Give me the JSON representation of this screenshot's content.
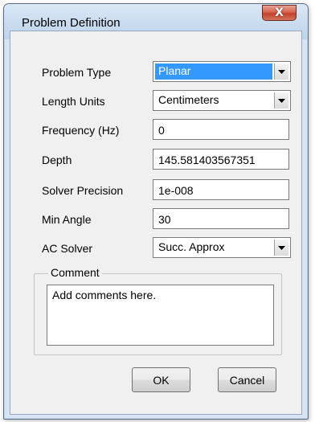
{
  "window": {
    "title": "Problem Definition",
    "close_label": "X"
  },
  "form": {
    "problem_type": {
      "label": "Problem Type",
      "value": "Planar"
    },
    "length_units": {
      "label": "Length Units",
      "value": "Centimeters"
    },
    "frequency": {
      "label": "Frequency (Hz)",
      "value": "0"
    },
    "depth": {
      "label": "Depth",
      "value": "145.581403567351"
    },
    "solver_precision": {
      "label": "Solver Precision",
      "value": "1e-008"
    },
    "min_angle": {
      "label": "Min Angle",
      "value": "30"
    },
    "ac_solver": {
      "label": "AC Solver",
      "value": "Succ. Approx"
    }
  },
  "comment": {
    "group_label": "Comment",
    "text": "Add comments here."
  },
  "buttons": {
    "ok": "OK",
    "cancel": "Cancel"
  }
}
